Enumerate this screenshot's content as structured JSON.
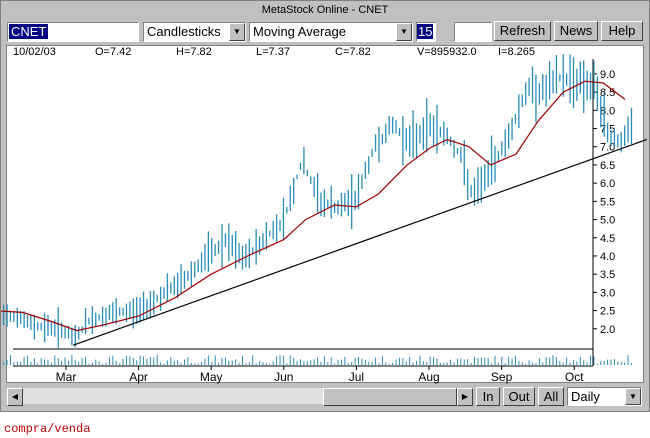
{
  "window": {
    "title": "MetaStock Online - CNET"
  },
  "toolbar": {
    "symbol": "CNET",
    "chart_type": "Candlesticks",
    "indicator": "Moving Average",
    "period": "15",
    "refresh_label": "Refresh",
    "news_label": "News",
    "help_label": "Help"
  },
  "quote": {
    "date": "10/02/03",
    "open": "O=7.42",
    "high": "H=7.82",
    "low": "L=7.37",
    "close": "C=7.82",
    "volume": "V=895932.0",
    "indicator": "I=8.265"
  },
  "colors": {
    "price": "#2a8db6",
    "moving_average": "#a00000",
    "trendline": "#000000",
    "footer": "#c00000"
  },
  "bottom": {
    "zoom_in_label": "In",
    "zoom_out_label": "Out",
    "all_label": "All",
    "period_select": "Daily"
  },
  "footer": {
    "text": "compra/venda"
  },
  "chart_data": {
    "type": "bar",
    "title": "",
    "y_ticks": [
      "9.0",
      "8.5",
      "8.0",
      "7.5",
      "7.0",
      "6.5",
      "6.0",
      "5.5",
      "5.0",
      "4.5",
      "4.0",
      "3.5",
      "3.0",
      "2.5",
      "2.0"
    ],
    "ylim": [
      1.5,
      9.3
    ],
    "months": [
      "Mar",
      "Apr",
      "May",
      "Jun",
      "Jul",
      "Aug",
      "Sep",
      "Oct"
    ],
    "price_anchors": [
      {
        "m": 0.0,
        "v": 2.5
      },
      {
        "m": 0.25,
        "v": 2.4
      },
      {
        "m": 0.55,
        "v": 2.1
      },
      {
        "m": 0.95,
        "v": 2.0
      },
      {
        "m": 1.1,
        "v": 1.7
      },
      {
        "m": 1.3,
        "v": 2.2
      },
      {
        "m": 1.6,
        "v": 2.4
      },
      {
        "m": 2.0,
        "v": 2.5
      },
      {
        "m": 2.3,
        "v": 2.9
      },
      {
        "m": 2.6,
        "v": 3.3
      },
      {
        "m": 2.9,
        "v": 3.9
      },
      {
        "m": 3.2,
        "v": 4.4
      },
      {
        "m": 3.45,
        "v": 3.9
      },
      {
        "m": 3.7,
        "v": 4.4
      },
      {
        "m": 4.0,
        "v": 5.0
      },
      {
        "m": 4.25,
        "v": 6.6
      },
      {
        "m": 4.5,
        "v": 5.5
      },
      {
        "m": 4.75,
        "v": 5.3
      },
      {
        "m": 5.0,
        "v": 5.6
      },
      {
        "m": 5.25,
        "v": 7.0
      },
      {
        "m": 5.5,
        "v": 7.6
      },
      {
        "m": 5.75,
        "v": 7.1
      },
      {
        "m": 6.0,
        "v": 7.6
      },
      {
        "m": 6.25,
        "v": 7.3
      },
      {
        "m": 6.45,
        "v": 6.7
      },
      {
        "m": 6.6,
        "v": 5.6
      },
      {
        "m": 6.85,
        "v": 6.4
      },
      {
        "m": 7.1,
        "v": 7.3
      },
      {
        "m": 7.35,
        "v": 8.6
      },
      {
        "m": 7.55,
        "v": 8.5
      },
      {
        "m": 7.8,
        "v": 8.9
      },
      {
        "m": 8.1,
        "v": 8.8
      },
      {
        "m": 8.3,
        "v": 8.6
      },
      {
        "m": 8.45,
        "v": 7.4
      },
      {
        "m": 8.65,
        "v": 7.1
      },
      {
        "m": 8.8,
        "v": 7.6
      }
    ],
    "moving_average": [
      {
        "m": 0.0,
        "v": 2.5
      },
      {
        "m": 0.4,
        "v": 2.45
      },
      {
        "m": 0.8,
        "v": 2.2
      },
      {
        "m": 1.15,
        "v": 1.95
      },
      {
        "m": 1.5,
        "v": 2.1
      },
      {
        "m": 2.0,
        "v": 2.35
      },
      {
        "m": 2.5,
        "v": 2.85
      },
      {
        "m": 3.0,
        "v": 3.5
      },
      {
        "m": 3.5,
        "v": 4.0
      },
      {
        "m": 4.0,
        "v": 4.45
      },
      {
        "m": 4.3,
        "v": 5.0
      },
      {
        "m": 4.7,
        "v": 5.4
      },
      {
        "m": 5.0,
        "v": 5.35
      },
      {
        "m": 5.3,
        "v": 5.7
      },
      {
        "m": 5.7,
        "v": 6.5
      },
      {
        "m": 6.0,
        "v": 6.95
      },
      {
        "m": 6.25,
        "v": 7.2
      },
      {
        "m": 6.55,
        "v": 7.0
      },
      {
        "m": 6.85,
        "v": 6.5
      },
      {
        "m": 7.2,
        "v": 6.8
      },
      {
        "m": 7.5,
        "v": 7.7
      },
      {
        "m": 7.85,
        "v": 8.5
      },
      {
        "m": 8.15,
        "v": 8.8
      },
      {
        "m": 8.4,
        "v": 8.75
      },
      {
        "m": 8.7,
        "v": 8.3
      }
    ],
    "trendline": [
      {
        "m": 1.1,
        "v": 1.55
      },
      {
        "m": 9.0,
        "v": 7.2
      }
    ]
  }
}
